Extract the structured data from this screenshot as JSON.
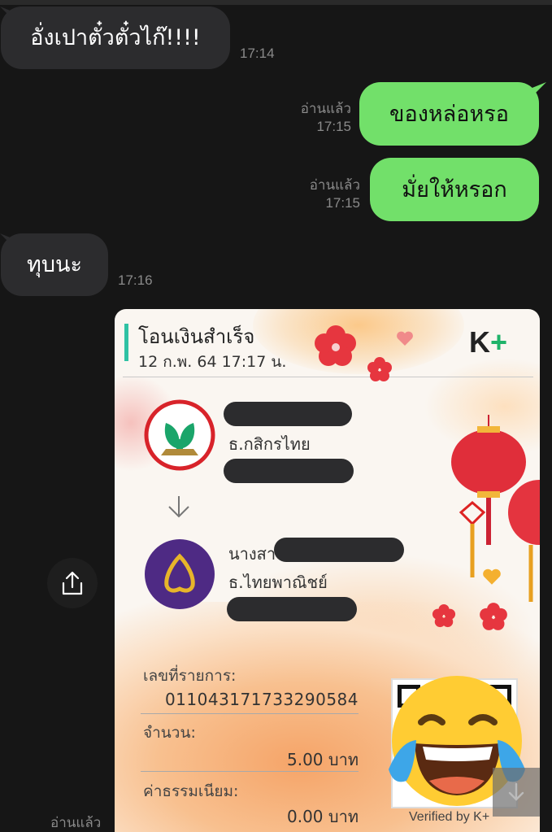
{
  "messages": [
    {
      "text": "อั่งเปาตั๋วตั๋วไก๊!!!!",
      "time": "17:14"
    },
    {
      "text": "ของหล่อหรอ",
      "read": "อ่านแล้ว",
      "time": "17:15"
    },
    {
      "text": "มั่ยให้หรอก",
      "read": "อ่านแล้ว",
      "time": "17:15"
    },
    {
      "text": "ทุบนะ",
      "time": "17:16"
    }
  ],
  "slip": {
    "title": "โอนเงินสำเร็จ",
    "date": "12 ก.พ. 64  17:17 น.",
    "logo_k": "K",
    "logo_plus": "+",
    "sender_bank": "ธ.กสิกรไทย",
    "receiver_prefix": "นางสา",
    "receiver_bank": "ธ.ไทยพาณิชย์",
    "ref_label": "เลขที่รายการ:",
    "ref_value": "011043171733290584",
    "amount_label": "จำนวน:",
    "amount_value": "5.00 บาท",
    "fee_label": "ค่าธรรมเนียม:",
    "fee_value": "0.00 บาท",
    "verified": "Verified by K+"
  },
  "bottom_read": "อ่านแล้ว",
  "colors": {
    "background": "#161616",
    "incoming": "#2c2c2e",
    "outgoing": "#72e06a",
    "kbank": "#1aa56a",
    "scb": "#4e2a84"
  },
  "icons": [
    "share-icon",
    "arrow-down-icon",
    "laughing-tears-emoji",
    "kbank-logo",
    "scb-logo"
  ]
}
